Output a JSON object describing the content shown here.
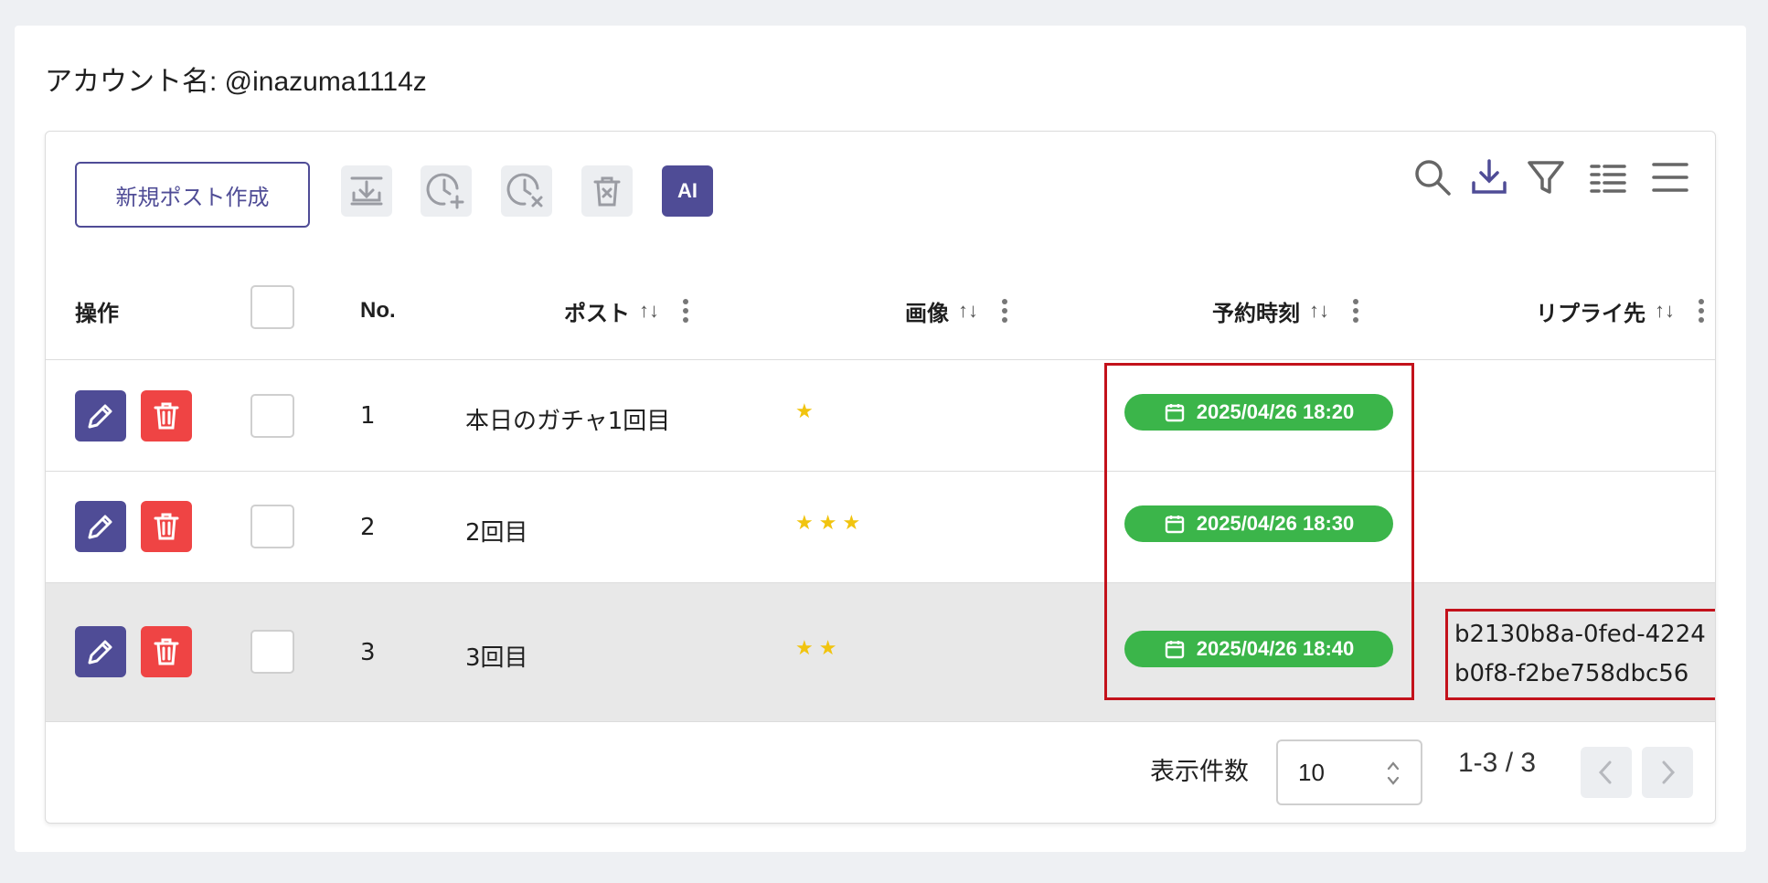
{
  "account": {
    "label": "アカウント名: @inazuma1114z"
  },
  "toolbar": {
    "new_post_label": "新規ポスト作成",
    "ai_label": "AI",
    "icons": [
      "import-icon",
      "schedule-add-icon",
      "schedule-cancel-icon",
      "delete-selected-icon",
      "ai-icon"
    ],
    "right_icons": [
      "search-icon",
      "download-icon",
      "filter-icon",
      "density-icon",
      "menu-icon"
    ]
  },
  "columns": {
    "actions": "操作",
    "no": "No.",
    "post": "ポスト",
    "image": "画像",
    "scheduled": "予約時刻",
    "reply": "リプライ先",
    "sort_glyph": "↑↓"
  },
  "rows": [
    {
      "no": "1",
      "post": "本日のガチャ1回目",
      "image_count": 1,
      "scheduled": "2025/04/26 18:20",
      "reply": [
        "",
        ""
      ]
    },
    {
      "no": "2",
      "post": "2回目",
      "image_count": 3,
      "scheduled": "2025/04/26 18:30",
      "reply": [
        "",
        ""
      ]
    },
    {
      "no": "3",
      "post": "3回目",
      "image_count": 2,
      "scheduled": "2025/04/26 18:40",
      "reply": [
        "b2130b8a-0fed-4224",
        "b0f8-f2be758dbc56"
      ]
    }
  ],
  "footer": {
    "rows_per_page_label": "表示件数",
    "rows_per_page_value": "10",
    "range": "1-3 / 3"
  },
  "colors": {
    "primary": "#4f4c96",
    "danger": "#ef4444",
    "badge": "#3bb54a",
    "highlight": "#c3121b",
    "selected_row": "#e8e8e8"
  }
}
